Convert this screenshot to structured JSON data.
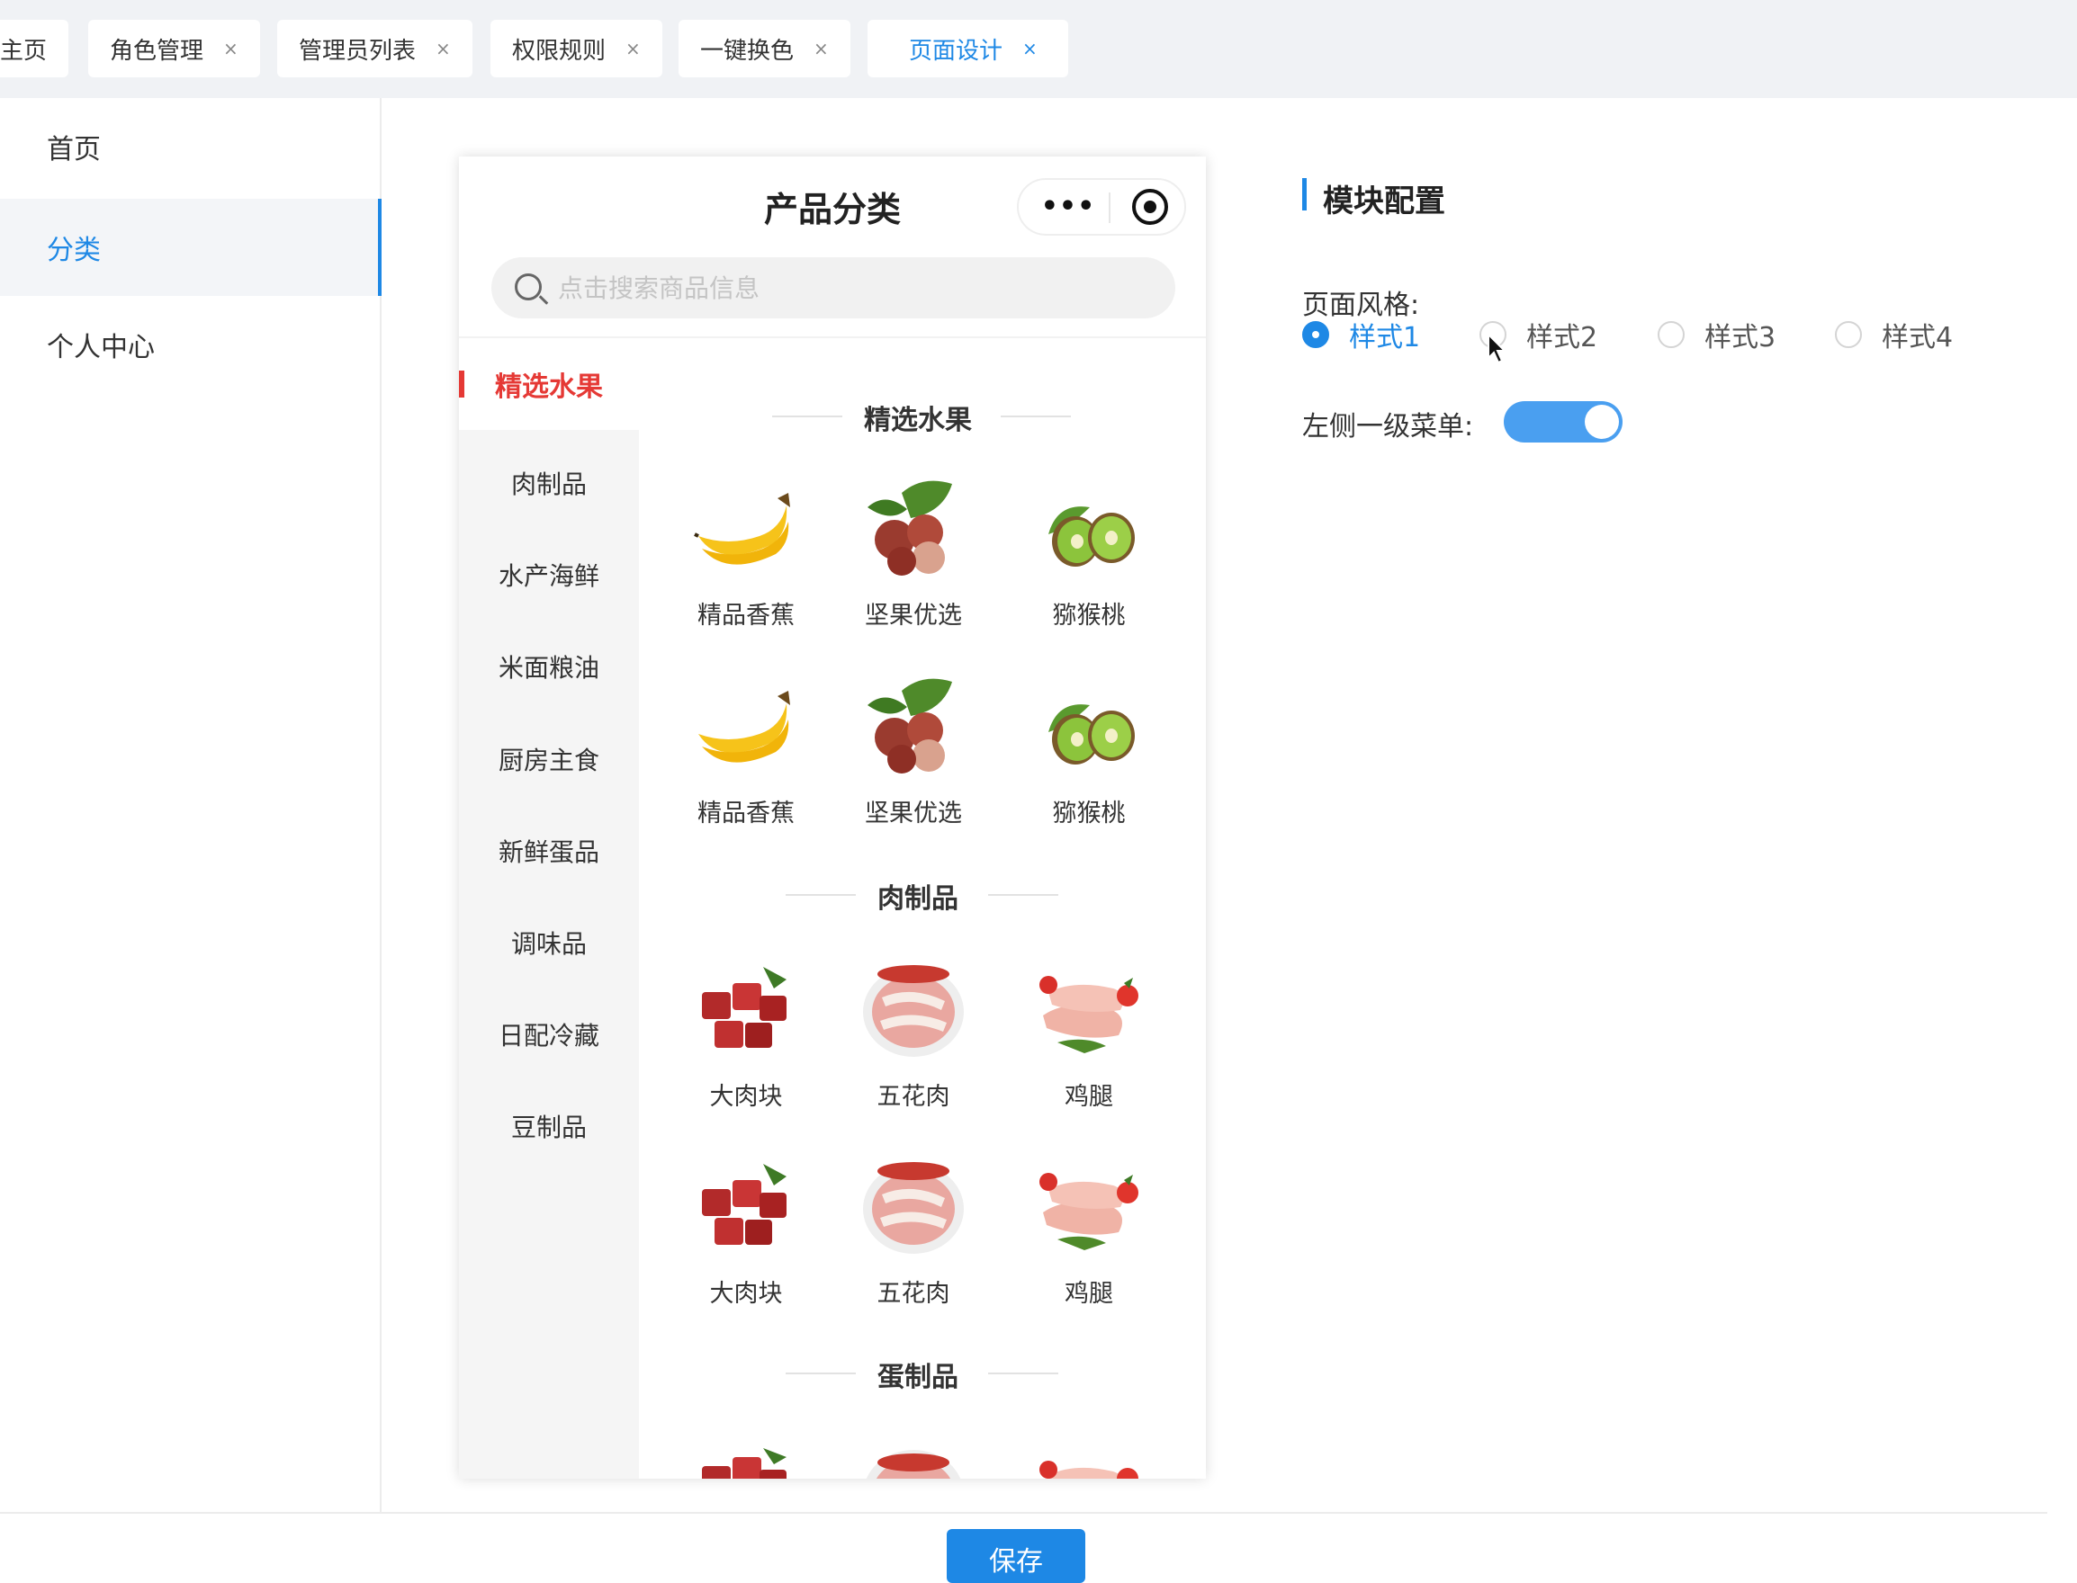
{
  "tabs": [
    {
      "label": "主页"
    },
    {
      "label": "角色管理",
      "close": "×"
    },
    {
      "label": "管理员列表",
      "close": "×"
    },
    {
      "label": "权限规则",
      "close": "×"
    },
    {
      "label": "一键换色",
      "close": "×"
    },
    {
      "label": "页面设计",
      "close": "×",
      "active": true
    }
  ],
  "nav": {
    "items": [
      {
        "label": "首页"
      },
      {
        "label": "分类",
        "active": true
      },
      {
        "label": "个人中心"
      }
    ]
  },
  "phone": {
    "title": "产品分类",
    "capsule_dots": "•••",
    "search_placeholder": "点击搜索商品信息",
    "categories": [
      "精选水果",
      "肉制品",
      "水产海鲜",
      "米面粮油",
      "厨房主食",
      "新鲜蛋品",
      "调味品",
      "日配冷藏",
      "豆制品"
    ],
    "active_category": "精选水果",
    "sections": [
      {
        "title": "精选水果",
        "products": [
          "精品香蕉",
          "坚果优选",
          "猕猴桃",
          "精品香蕉",
          "坚果优选",
          "猕猴桃"
        ]
      },
      {
        "title": "肉制品",
        "products": [
          "大肉块",
          "五花肉",
          "鸡腿",
          "大肉块",
          "五花肉",
          "鸡腿"
        ]
      },
      {
        "title": "蛋制品",
        "products": []
      }
    ]
  },
  "config": {
    "title": "模块配置",
    "style_label": "页面风格:",
    "styles": [
      "样式1",
      "样式2",
      "样式3",
      "样式4"
    ],
    "selected_style": "样式1",
    "left_menu_label": "左侧一级菜单:",
    "left_menu_enabled": true
  },
  "footer": {
    "save_label": "保存"
  },
  "colors": {
    "accent": "#1e88e5",
    "category_active": "#e53935",
    "toggle_on": "#4a9ff0"
  }
}
